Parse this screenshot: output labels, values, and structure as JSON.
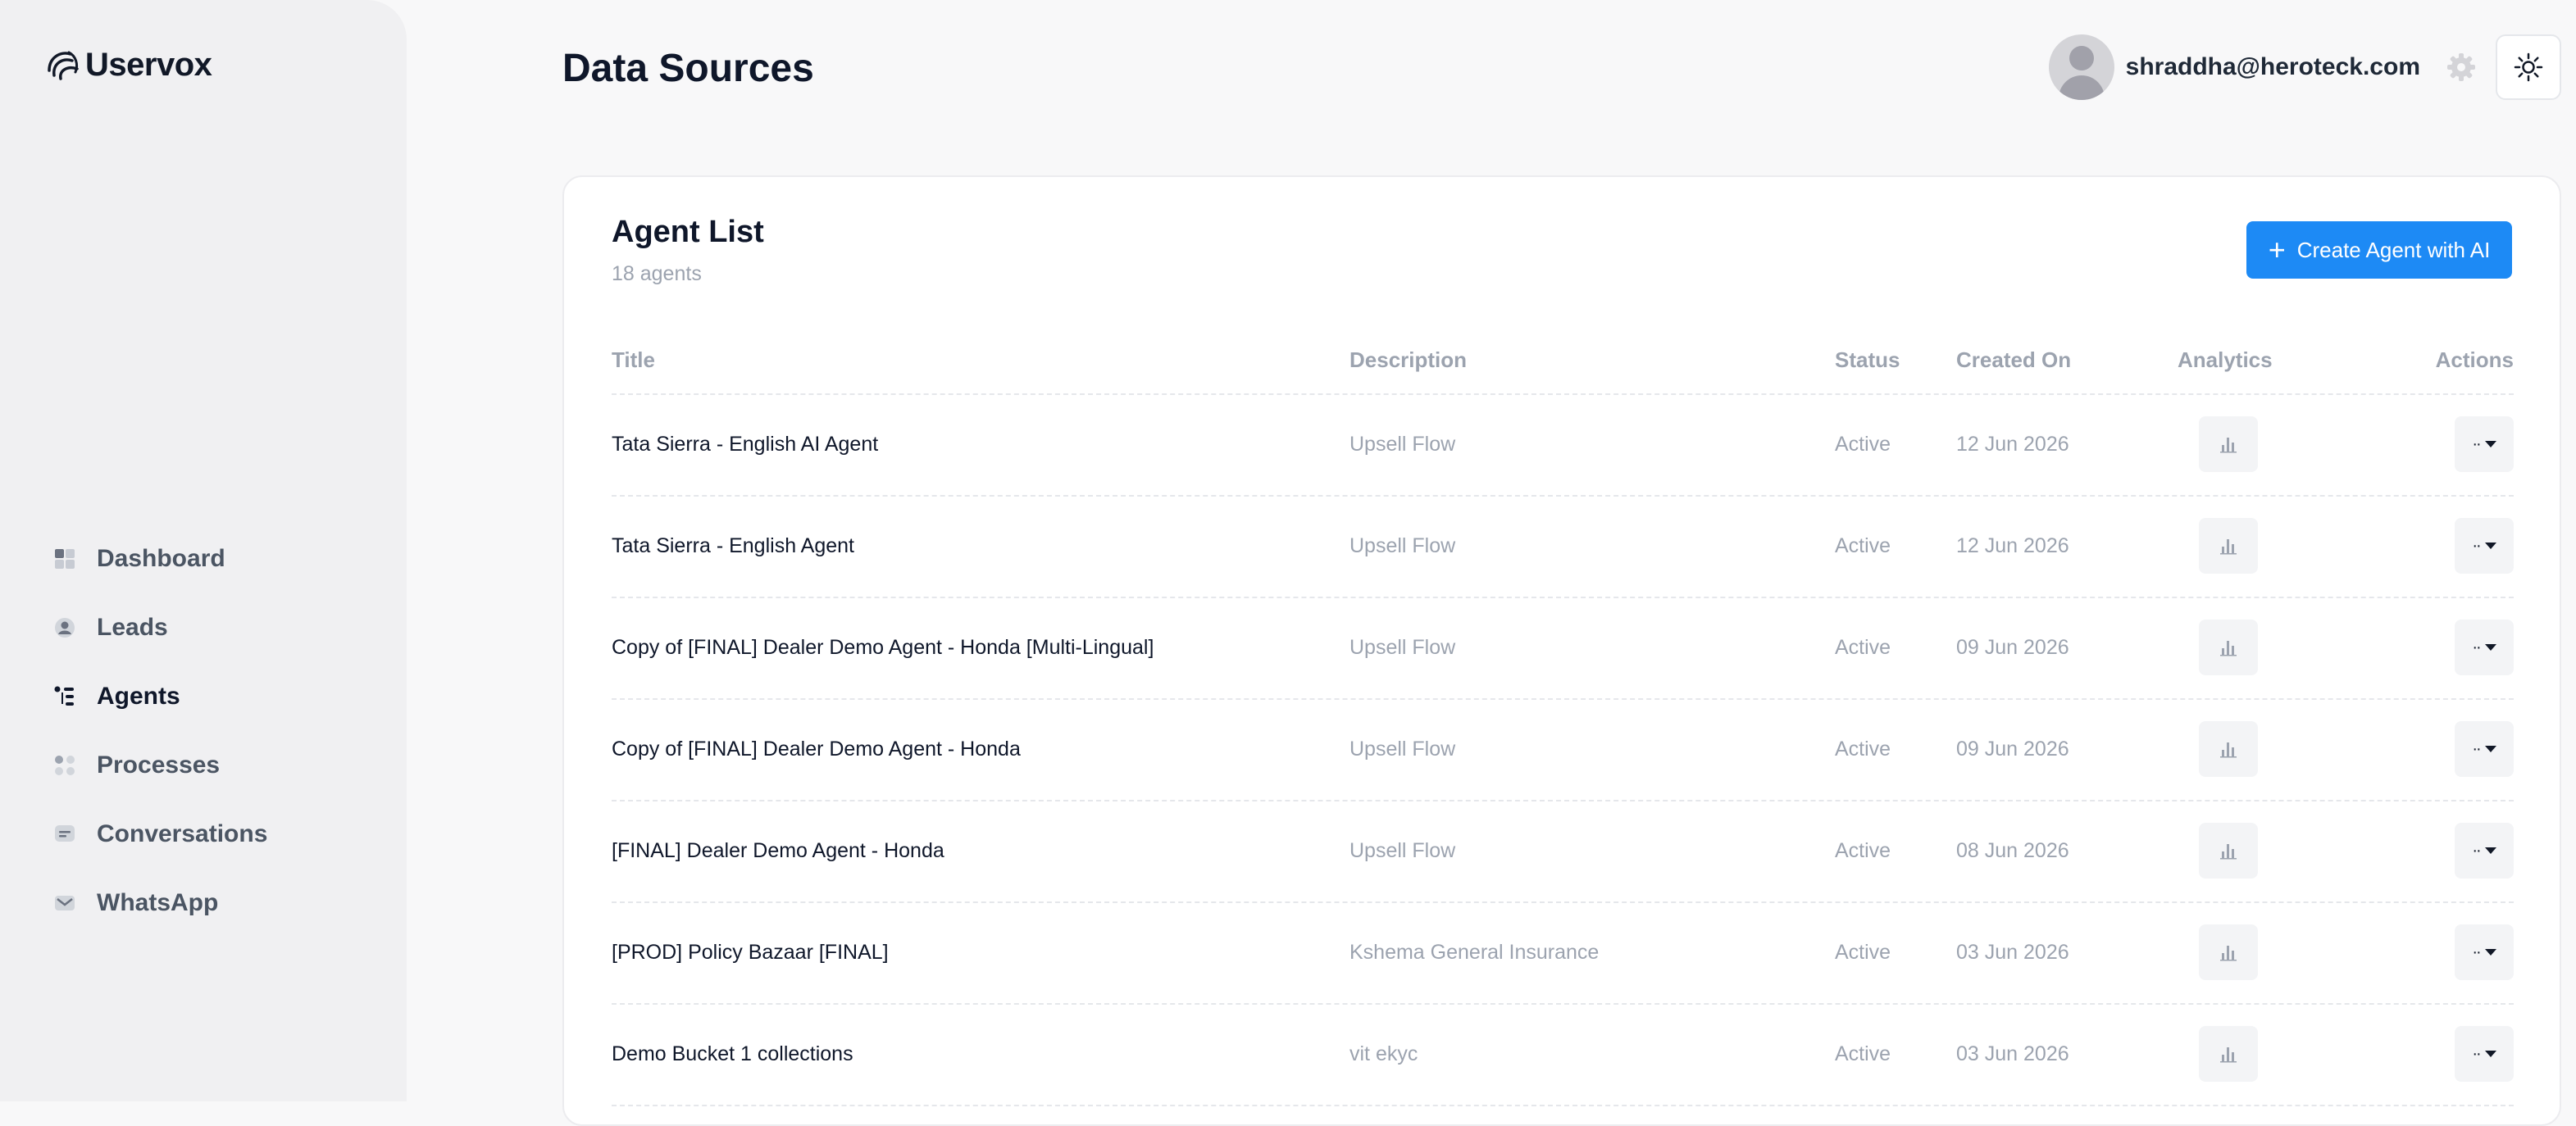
{
  "brand": {
    "name": "Uservox"
  },
  "sidebar": {
    "items": [
      {
        "label": "Dashboard",
        "icon": "dashboard-icon",
        "active": false
      },
      {
        "label": "Leads",
        "icon": "user-circle-icon",
        "active": false
      },
      {
        "label": "Agents",
        "icon": "agents-list-icon",
        "active": true
      },
      {
        "label": "Processes",
        "icon": "processes-icon",
        "active": false
      },
      {
        "label": "Conversations",
        "icon": "chat-icon",
        "active": false
      },
      {
        "label": "WhatsApp",
        "icon": "mail-icon",
        "active": false
      }
    ]
  },
  "header": {
    "title": "Data Sources",
    "user_email": "shraddha@heroteck.com",
    "settings_icon": "gear-icon",
    "theme_icon": "sun-icon"
  },
  "agent_list": {
    "title": "Agent List",
    "count_text": "18 agents",
    "create_button": "Create Agent with AI",
    "columns": {
      "title": "Title",
      "description": "Description",
      "status": "Status",
      "created_on": "Created On",
      "analytics": "Analytics",
      "actions": "Actions"
    },
    "rows": [
      {
        "title": "Tata Sierra - English AI Agent",
        "description": "Upsell Flow",
        "status": "Active",
        "created_on": "12 Jun 2026"
      },
      {
        "title": "Tata Sierra - English Agent",
        "description": "Upsell Flow",
        "status": "Active",
        "created_on": "12 Jun 2026"
      },
      {
        "title": "Copy of [FINAL] Dealer Demo Agent - Honda [Multi-Lingual]",
        "description": "Upsell Flow",
        "status": "Active",
        "created_on": "09 Jun 2026"
      },
      {
        "title": "Copy of [FINAL] Dealer Demo Agent - Honda",
        "description": "Upsell Flow",
        "status": "Active",
        "created_on": "09 Jun 2026"
      },
      {
        "title": "[FINAL] Dealer Demo Agent - Honda",
        "description": "Upsell Flow",
        "status": "Active",
        "created_on": "08 Jun 2026"
      },
      {
        "title": "[PROD] Policy Bazaar [FINAL]",
        "description": "Kshema General Insurance",
        "status": "Active",
        "created_on": "03 Jun 2026"
      },
      {
        "title": "Demo Bucket 1 collections",
        "description": "vit ekyc",
        "status": "Active",
        "created_on": "03 Jun 2026"
      }
    ]
  },
  "colors": {
    "accent": "#1d8af5",
    "sidebar_bg": "#f0f0f2",
    "page_bg": "#f8f8f9",
    "muted_text": "#9ca3af"
  }
}
